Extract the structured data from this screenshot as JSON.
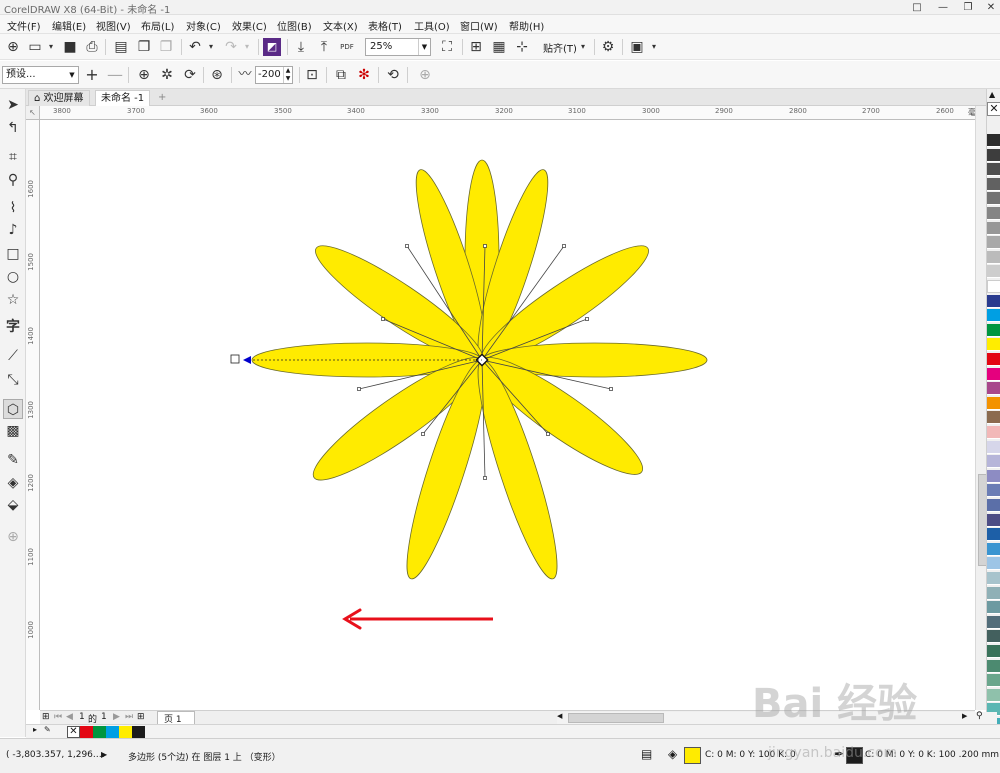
{
  "window": {
    "title": "CorelDRAW X8 (64-Bit) - 未命名 -1",
    "controls": [
      "□",
      "—",
      "❐",
      "✕"
    ]
  },
  "menu": [
    "文件(F)",
    "编辑(E)",
    "视图(V)",
    "布局(L)",
    "对象(C)",
    "效果(C)",
    "位图(B)",
    "文本(X)",
    "表格(T)",
    "工具(O)",
    "窗口(W)",
    "帮助(H)"
  ],
  "toolbar": {
    "zoom": "25%",
    "snap_label": "贴齐(T)"
  },
  "property_bar": {
    "preset": "预设...",
    "distortion_amplitude": "-200"
  },
  "tabs": {
    "welcome": "欢迎屏幕",
    "document": "未命名 -1",
    "add": "+"
  },
  "ruler": {
    "h_labels": [
      "3800",
      "3700",
      "3600",
      "3500",
      "3400",
      "3300",
      "3200",
      "3100",
      "3000",
      "2900",
      "2800",
      "2700",
      "2600"
    ],
    "units": "毫米",
    "v_labels": [
      "1600",
      "1500",
      "1400",
      "1300",
      "1200",
      "1100",
      "1000"
    ]
  },
  "page_nav": {
    "current": "1",
    "of": "的",
    "total": "1",
    "page_tab": "页 1"
  },
  "status": {
    "coordinates": "( -3,803.357, 1,296.…",
    "object_info": "多边形 (5个边) 在 图层 1 上 （变形）",
    "fill_info": "C: 0 M: 0 Y: 100 K: 0",
    "outline_info": "C: 0 M: 0 Y: 0 K: 100  .200 mm"
  },
  "colors": {
    "petal_fill": "#FFEB00",
    "petal_outline": "#6b6b2a",
    "arrow": "#E8101B",
    "handle_blue": "#0000CC",
    "outline_swatch": "#1c1c1c",
    "palette": [
      "#2b2b2b",
      "#3d3d3d",
      "#4f4f4f",
      "#616161",
      "#737373",
      "#858585",
      "#979797",
      "#a9a9a9",
      "#bbbbbb",
      "#cdcdcd",
      "#ffffff",
      "#2a3b8f",
      "#009fe3",
      "#009640",
      "#ffed00",
      "#e30613",
      "#e5007e",
      "#a8478c",
      "#f39200",
      "#8b6b4f",
      "#f2b8b8",
      "#d6d6ea",
      "#b6b5d9",
      "#8d8cc3",
      "#6b7db5",
      "#5b6fa8",
      "#4d4d85",
      "#1d5fa7",
      "#3a95d1",
      "#9dc5e6",
      "#a7c3cc",
      "#8fb0b6",
      "#6d9aa1",
      "#526d7a",
      "#43605e",
      "#39725a",
      "#4c8a70",
      "#6aa68c",
      "#8fc1ab",
      "#5bb7b3",
      "#44aeb9"
    ],
    "doc_palette": [
      "#E30613",
      "#009640",
      "#009FE3",
      "#FFED00",
      "#1c1c1c"
    ]
  },
  "watermark": {
    "text": "Bai 经验",
    "url": "jingyan.baidu.com"
  }
}
